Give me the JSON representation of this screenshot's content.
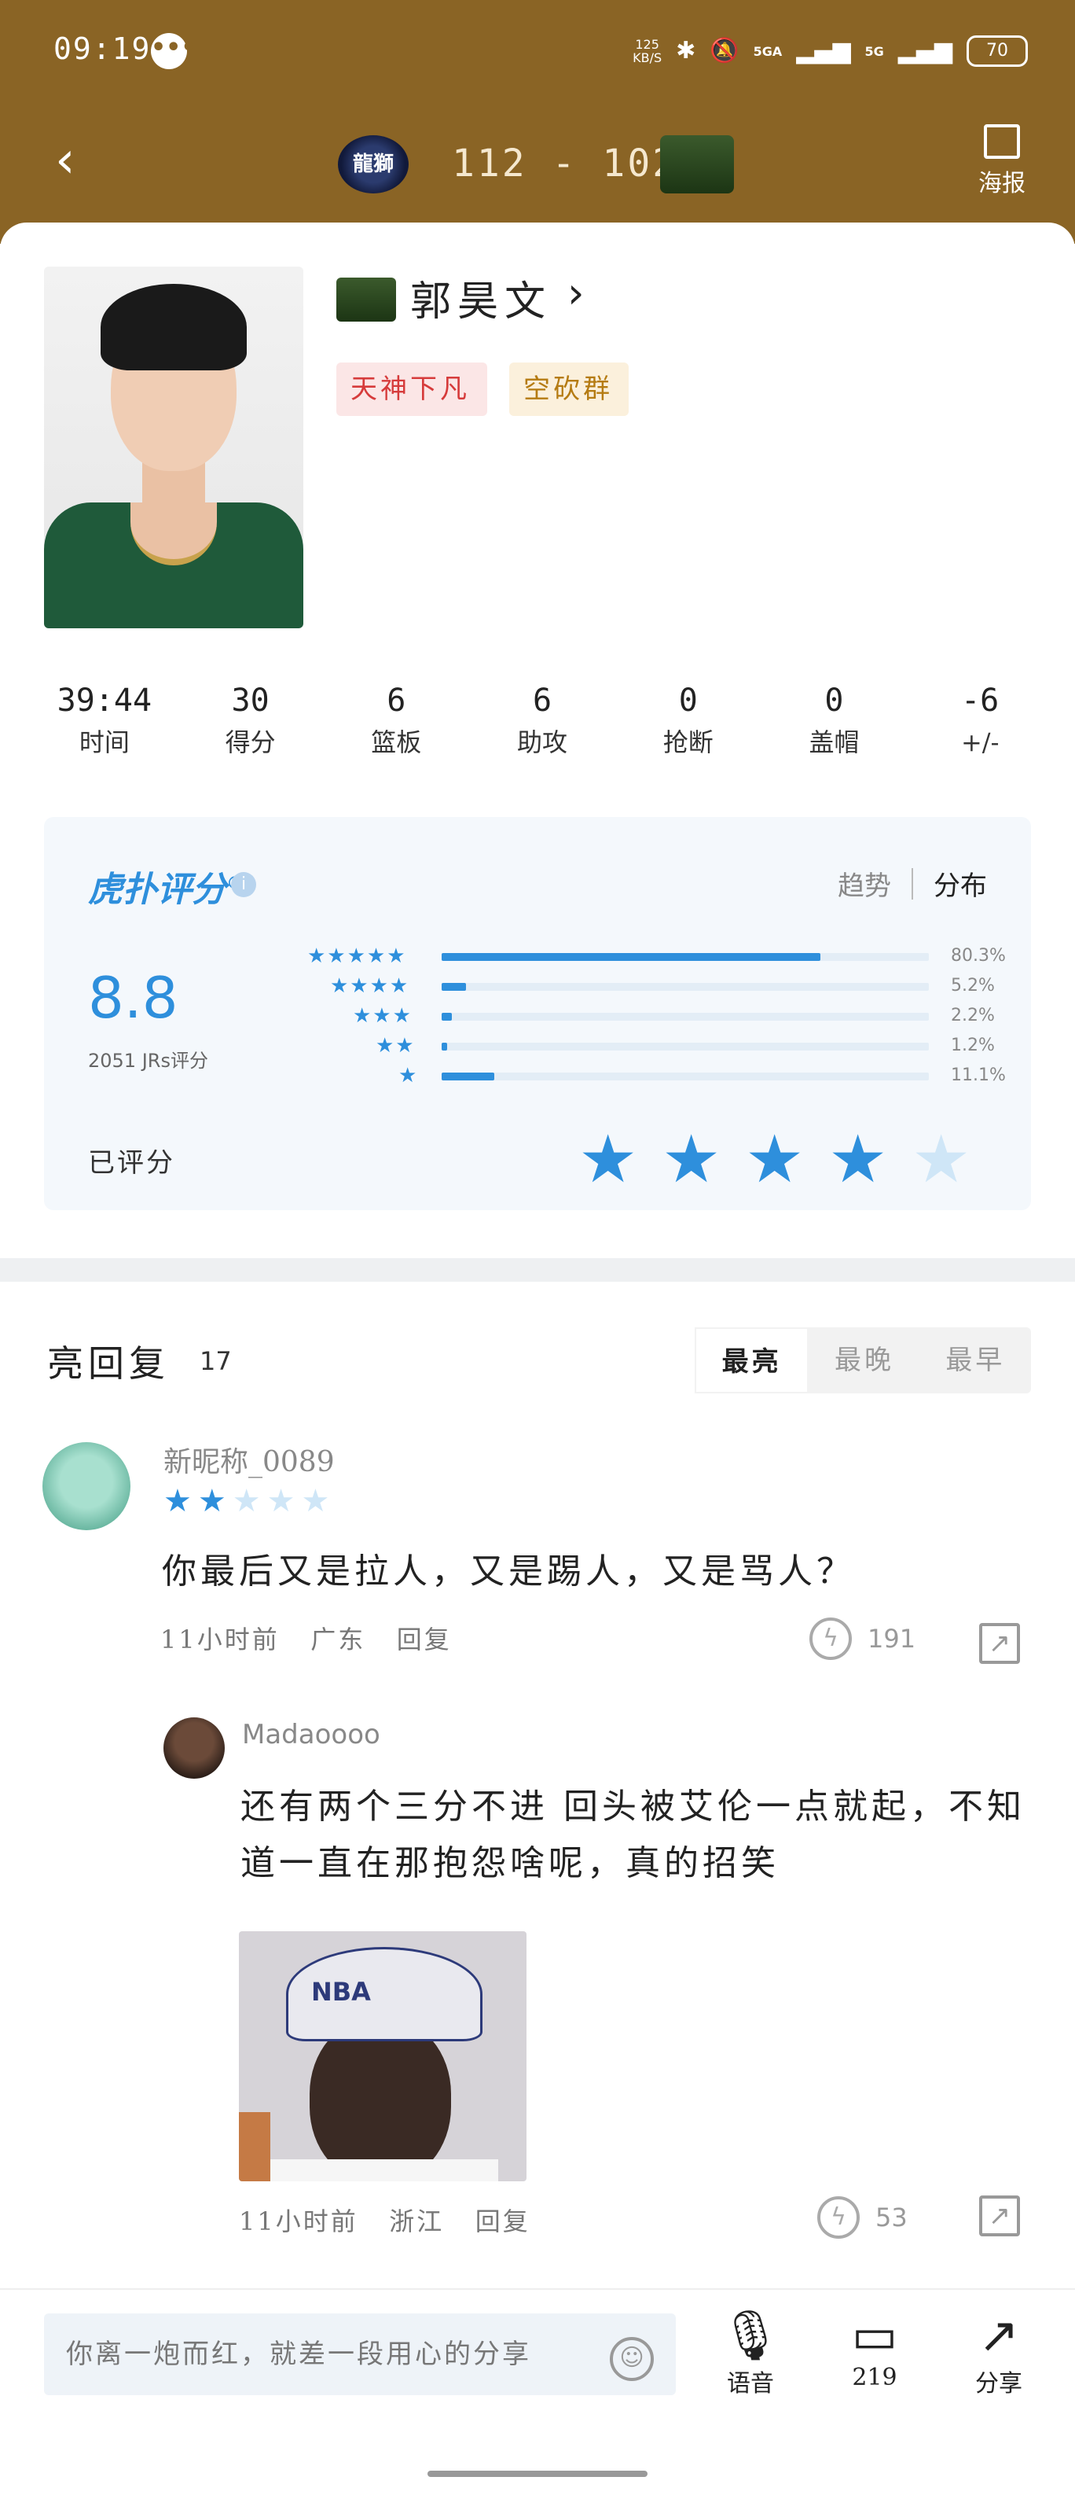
{
  "status_bar": {
    "time": "09:19",
    "net_speed_value": "125",
    "net_speed_unit": "KB/S",
    "signal_1": "5GA",
    "signal_2": "5G",
    "battery": "70"
  },
  "nav": {
    "home_score": "112",
    "away_score": "102",
    "score_sep": "-",
    "home_team_logo_text": "龍獅",
    "poster_label": "海报"
  },
  "player": {
    "name": "郭昊文",
    "tags": [
      "天神下凡",
      "空砍群"
    ]
  },
  "stats": [
    {
      "value": "39:44",
      "label": "时间"
    },
    {
      "value": "30",
      "label": "得分"
    },
    {
      "value": "6",
      "label": "篮板"
    },
    {
      "value": "6",
      "label": "助攻"
    },
    {
      "value": "0",
      "label": "抢断"
    },
    {
      "value": "0",
      "label": "盖帽"
    },
    {
      "value": "-6",
      "label": "+/-"
    }
  ],
  "rating": {
    "brand": "虎扑评分",
    "brand_mark": "®",
    "tab_trend": "趋势",
    "tab_distribution": "分布",
    "score": "8.8",
    "count_text": "2051 JRs评分",
    "distribution": [
      {
        "stars": 5,
        "percent": 80.3,
        "label": "80.3%"
      },
      {
        "stars": 4,
        "percent": 5.2,
        "label": "5.2%"
      },
      {
        "stars": 3,
        "percent": 2.2,
        "label": "2.2%"
      },
      {
        "stars": 2,
        "percent": 1.2,
        "label": "1.2%"
      },
      {
        "stars": 1,
        "percent": 11.1,
        "label": "11.1%"
      }
    ],
    "rated_label": "已评分",
    "my_rating": 4,
    "star_color": "#2e8fdc",
    "star_empty_color": "#cfe6f7"
  },
  "replies": {
    "title": "亮回复",
    "count": "17",
    "sort_tabs": [
      "最亮",
      "最晚",
      "最早"
    ],
    "active_sort": 0,
    "items": [
      {
        "nickname": "新昵称_0089",
        "stars": 2,
        "text": "你最后又是拉人，又是踢人，又是骂人？",
        "time": "11小时前",
        "location": "广东",
        "reply_label": "回复",
        "likes": "191"
      },
      {
        "nickname": "Madaoooo",
        "text": "还有两个三分不进 回头被艾伦一点就起，不知道一直在那抱怨啥呢，真的招笑",
        "image_cap_text": "NBA",
        "time": "11小时前",
        "location": "浙江",
        "reply_label": "回复",
        "likes": "53"
      }
    ]
  },
  "bottom_bar": {
    "input_placeholder": "你离一炮而红，就差一段用心的分享",
    "voice_label": "语音",
    "reply_count": "219",
    "share_label": "分享"
  }
}
